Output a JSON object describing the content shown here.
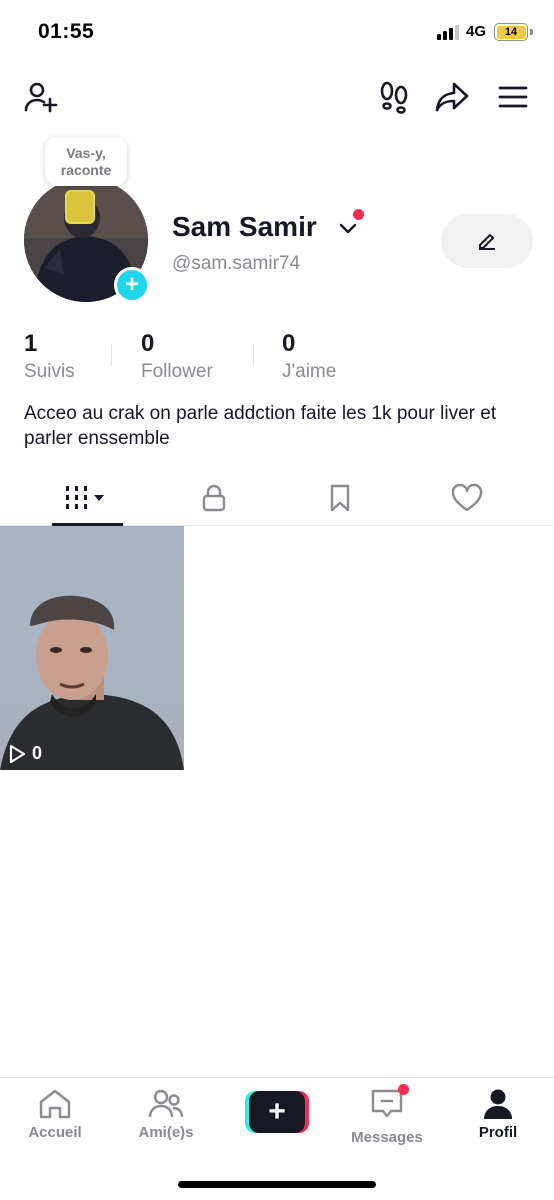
{
  "status_bar": {
    "time": "01:55",
    "network": "4G",
    "battery": "14"
  },
  "top_nav": {
    "icons": [
      "add-friend-icon",
      "footprints-icon",
      "share-icon",
      "menu-icon"
    ]
  },
  "profile": {
    "note_bubble_line1": "Vas-y,",
    "note_bubble_line2": "raconte",
    "display_name": "Sam Samir",
    "username": "@sam.samir74",
    "bio": "Acceo au crak on parle addction faite les 1k pour liver et parler enssemble"
  },
  "stats": [
    {
      "value": "1",
      "label": "Suivis"
    },
    {
      "value": "0",
      "label": "Follower"
    },
    {
      "value": "0",
      "label": "J'aime"
    }
  ],
  "tabs": [
    "videos-grid-icon",
    "lock-icon",
    "bookmark-icon",
    "heart-icon"
  ],
  "videos": [
    {
      "views": "0"
    }
  ],
  "bottom_nav": {
    "items": [
      {
        "label": "Accueil",
        "icon": "home-icon"
      },
      {
        "label": "Ami(e)s",
        "icon": "friends-icon"
      },
      {
        "label": "Messages",
        "icon": "inbox-icon"
      },
      {
        "label": "Profil",
        "icon": "profile-icon"
      }
    ],
    "create_label": "+"
  },
  "colors": {
    "accent_red": "#fe2c55",
    "accent_cyan": "#25f4ee",
    "add_button_blue": "#20d5ec",
    "text_primary": "#161823",
    "text_secondary": "#8a8b91"
  }
}
